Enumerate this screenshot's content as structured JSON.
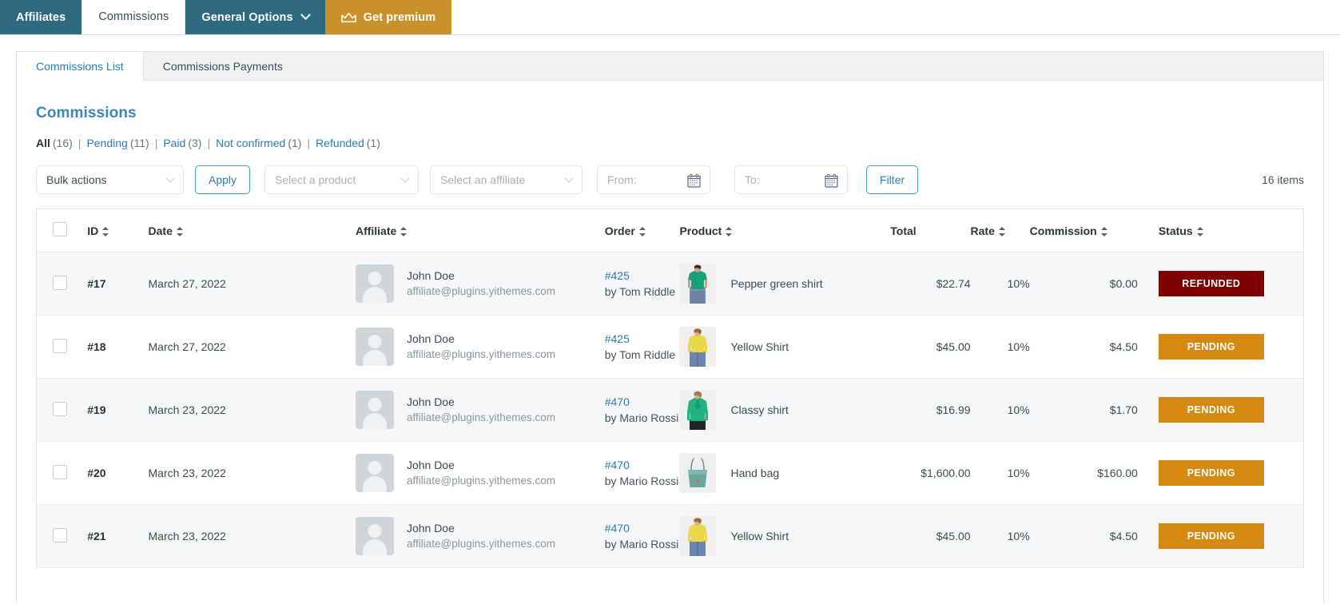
{
  "topnav": [
    {
      "label": "Affiliates",
      "style": "teal",
      "icon": null,
      "caret": false,
      "active": false
    },
    {
      "label": "Commissions",
      "style": "active",
      "icon": null,
      "caret": false,
      "active": true
    },
    {
      "label": "General Options",
      "style": "teal",
      "icon": null,
      "caret": true,
      "active": false
    },
    {
      "label": "Get premium",
      "style": "gold",
      "icon": "crown-icon",
      "caret": false,
      "active": false
    }
  ],
  "subtabs": [
    {
      "label": "Commissions List",
      "active": true
    },
    {
      "label": "Commissions Payments",
      "active": false
    }
  ],
  "page": {
    "title": "Commissions",
    "items_count": "16 items"
  },
  "status_links": [
    {
      "label": "All",
      "count": "(16)",
      "current": true
    },
    {
      "label": "Pending",
      "count": "(11)",
      "current": false
    },
    {
      "label": "Paid",
      "count": "(3)",
      "current": false
    },
    {
      "label": "Not confirmed",
      "count": "(1)",
      "current": false
    },
    {
      "label": "Refunded",
      "count": "(1)",
      "current": false
    }
  ],
  "toolbar": {
    "bulk_actions": "Bulk actions",
    "apply_label": "Apply",
    "select_product_placeholder": "Select a product",
    "select_affiliate_placeholder": "Select an affiliate",
    "from_placeholder": "From:",
    "to_placeholder": "To:",
    "from_value": "",
    "to_value": "",
    "filter_label": "Filter"
  },
  "table": {
    "columns": [
      {
        "key": "checkbox",
        "label": "",
        "sortable": false
      },
      {
        "key": "id",
        "label": "ID",
        "sortable": true
      },
      {
        "key": "date",
        "label": "Date",
        "sortable": true
      },
      {
        "key": "affiliate",
        "label": "Affiliate",
        "sortable": true
      },
      {
        "key": "order",
        "label": "Order",
        "sortable": true
      },
      {
        "key": "product",
        "label": "Product",
        "sortable": true
      },
      {
        "key": "total",
        "label": "Total",
        "sortable": false
      },
      {
        "key": "rate",
        "label": "Rate",
        "sortable": true
      },
      {
        "key": "commission",
        "label": "Commission",
        "sortable": true
      },
      {
        "key": "status",
        "label": "Status",
        "sortable": true
      }
    ],
    "rows": [
      {
        "id": "#17",
        "date": "March 27, 2022",
        "affiliate_name": "John Doe",
        "affiliate_email": "affiliate@plugins.yithemes.com",
        "order_id": "#425",
        "order_by": "by Tom Riddle",
        "product": "Pepper green shirt",
        "product_thumb": "green-tshirt",
        "total": "$22.74",
        "rate": "10%",
        "commission": "$0.00",
        "status": "REFUNDED",
        "status_kind": "refunded"
      },
      {
        "id": "#18",
        "date": "March 27, 2022",
        "affiliate_name": "John Doe",
        "affiliate_email": "affiliate@plugins.yithemes.com",
        "order_id": "#425",
        "order_by": "by Tom Riddle",
        "product": "Yellow Shirt",
        "product_thumb": "yellow-shirt",
        "total": "$45.00",
        "rate": "10%",
        "commission": "$4.50",
        "status": "PENDING",
        "status_kind": "pending"
      },
      {
        "id": "#19",
        "date": "March 23, 2022",
        "affiliate_name": "John Doe",
        "affiliate_email": "affiliate@plugins.yithemes.com",
        "order_id": "#470",
        "order_by": "by Mario Rossi",
        "product": "Classy shirt",
        "product_thumb": "green-blouse",
        "total": "$16.99",
        "rate": "10%",
        "commission": "$1.70",
        "status": "PENDING",
        "status_kind": "pending"
      },
      {
        "id": "#20",
        "date": "March 23, 2022",
        "affiliate_name": "John Doe",
        "affiliate_email": "affiliate@plugins.yithemes.com",
        "order_id": "#470",
        "order_by": "by Mario Rossi",
        "product": "Hand bag",
        "product_thumb": "hand-bag",
        "total": "$1,600.00",
        "rate": "10%",
        "commission": "$160.00",
        "status": "PENDING",
        "status_kind": "pending"
      },
      {
        "id": "#21",
        "date": "March 23, 2022",
        "affiliate_name": "John Doe",
        "affiliate_email": "affiliate@plugins.yithemes.com",
        "order_id": "#470",
        "order_by": "by Mario Rossi",
        "product": "Yellow Shirt",
        "product_thumb": "yellow-shirt",
        "total": "$45.00",
        "rate": "10%",
        "commission": "$4.50",
        "status": "PENDING",
        "status_kind": "pending"
      }
    ]
  },
  "colors": {
    "nav_teal": "#2d6a7f",
    "nav_gold": "#c8912a",
    "link_blue": "#2b7cb0",
    "title_blue": "#3c87b8",
    "badge_refunded": "#800000",
    "badge_pending": "#d68910"
  }
}
